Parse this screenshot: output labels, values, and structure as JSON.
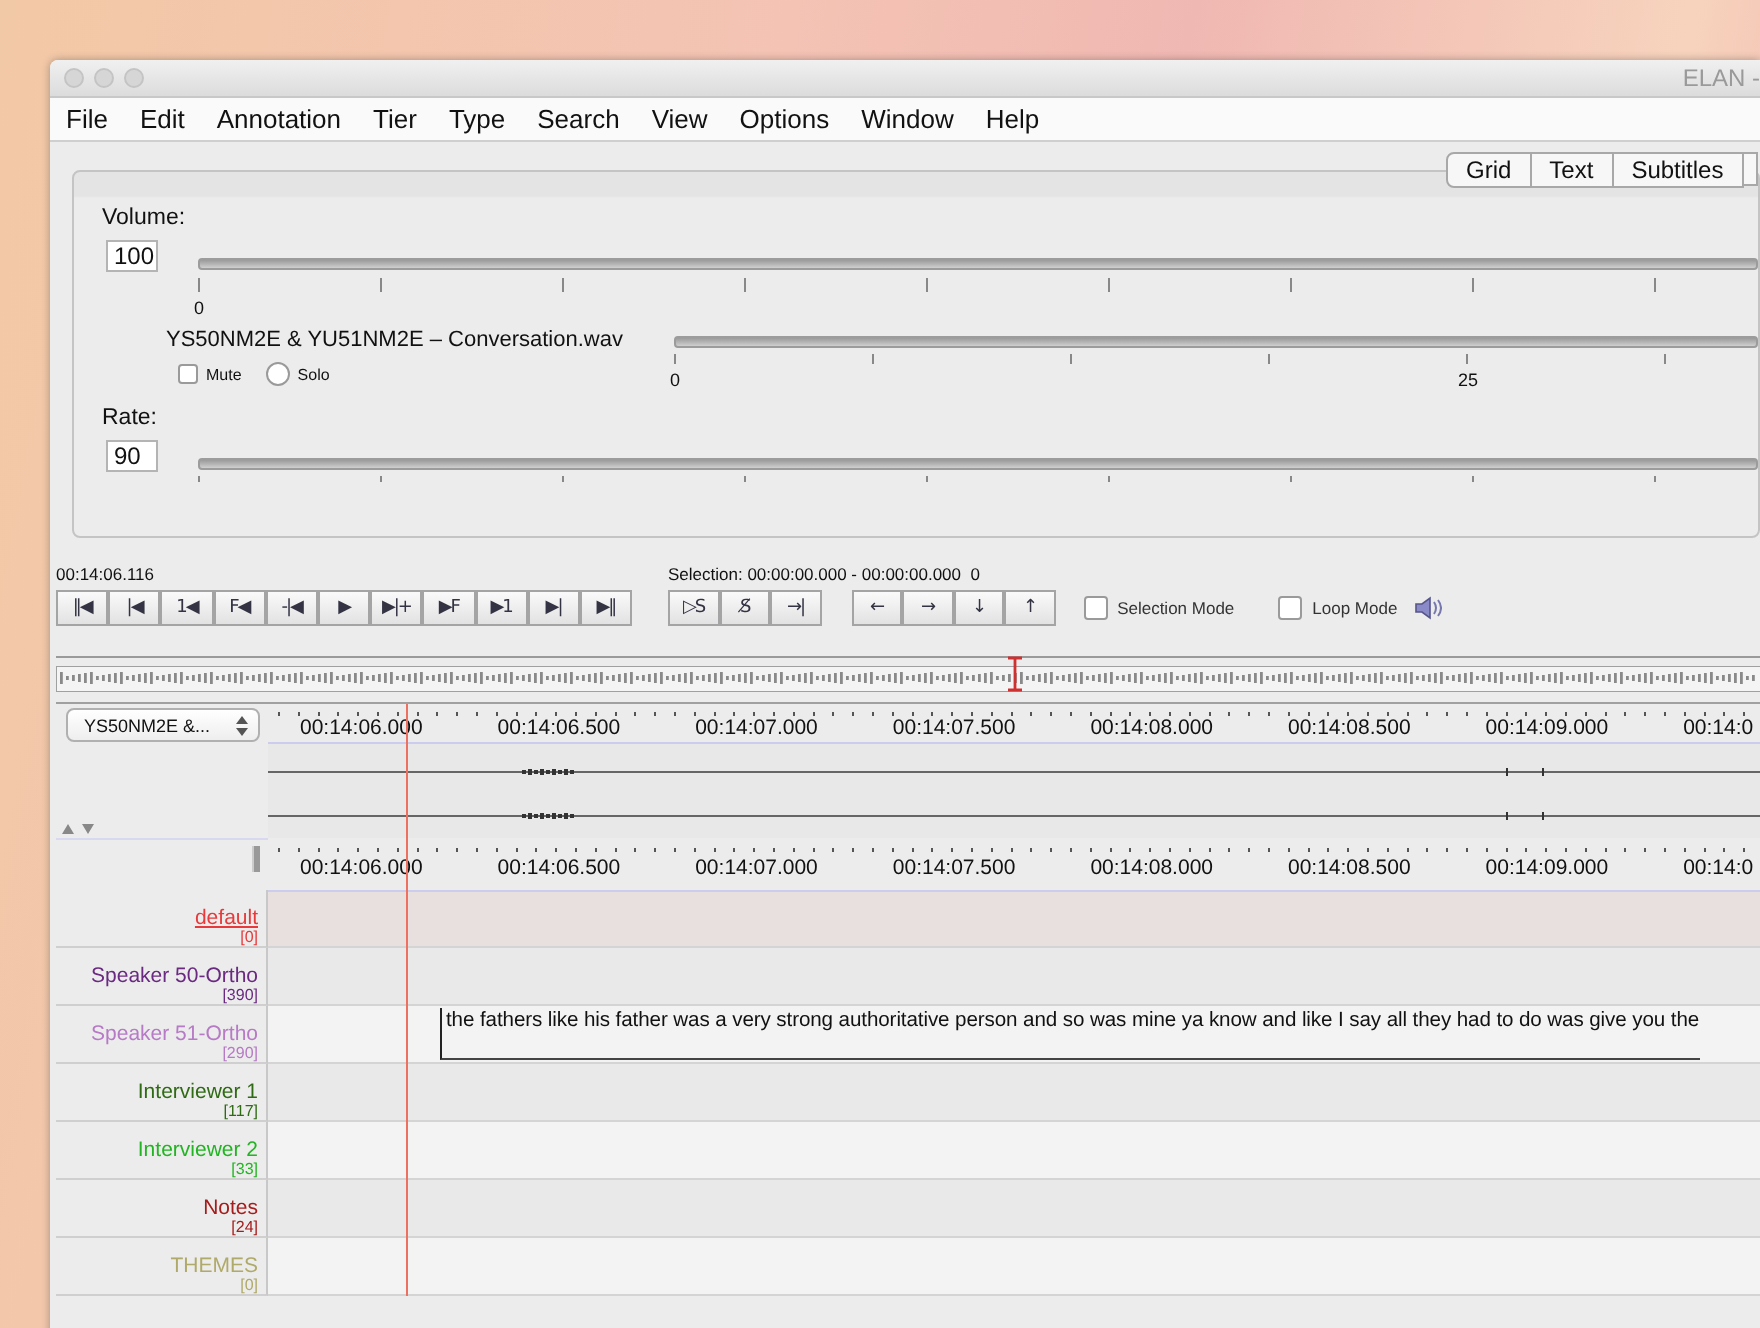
{
  "window": {
    "title": "ELAN - "
  },
  "menu": [
    "File",
    "Edit",
    "Annotation",
    "Tier",
    "Type",
    "Search",
    "View",
    "Options",
    "Window",
    "Help"
  ],
  "view_tabs": [
    {
      "label": "Grid",
      "selected": false
    },
    {
      "label": "Text",
      "selected": false
    },
    {
      "label": "Subtitles",
      "selected": false
    }
  ],
  "volume": {
    "label": "Volume:",
    "value": "100",
    "ticks": [
      "0"
    ]
  },
  "media_track": {
    "file": "YS50NM2E & YU51NM2E – Conversation.wav",
    "mute": {
      "label": "Mute",
      "checked": false
    },
    "solo": {
      "label": "Solo",
      "selected": false
    },
    "ticks": [
      "0",
      "25"
    ]
  },
  "rate": {
    "label": "Rate:",
    "value": "90"
  },
  "player": {
    "time": "00:14:06.116",
    "selection": "Selection: 00:00:00.000 - 00:00:00.000  0",
    "buttons": [
      "‖◀",
      "|◀",
      "1◀",
      "F◀",
      "-|◀",
      "▶",
      "▶|+",
      "▶F",
      "▶1",
      "▶|",
      "▶‖"
    ],
    "selection_buttons": [
      "▷S",
      "S̸",
      "→|"
    ],
    "nav_buttons": [
      "←",
      "→",
      "↓",
      "↑"
    ],
    "options": [
      {
        "label": "Selection Mode",
        "checked": false
      },
      {
        "label": "Loop Mode",
        "checked": false
      }
    ]
  },
  "timeline": {
    "tier_selector": "YS50NM2E &...",
    "ruler": [
      "00:14:06.000",
      "00:14:06.500",
      "00:14:07.000",
      "00:14:07.500",
      "00:14:08.000",
      "00:14:08.500",
      "00:14:09.000",
      "00:14:0"
    ],
    "tier_ruler": [
      "00:14:06.000",
      "00:14:06.500",
      "00:14:07.000",
      "00:14:07.500",
      "00:14:08.000",
      "00:14:08.500",
      "00:14:09.000",
      "00:14:0"
    ]
  },
  "tiers": [
    {
      "name": "default",
      "count": "[0]",
      "color": "#e83a3a",
      "selected": true
    },
    {
      "name": "Speaker 50-Ortho",
      "count": "[390]",
      "color": "#6a2a82",
      "selected": false
    },
    {
      "name": "Speaker 51-Ortho",
      "count": "[290]",
      "color": "#b67ac6",
      "selected": false,
      "annotations": [
        "the fathers like his father was a very strong authoritative person and so was mine ya know and like I say all they had to do was give you the"
      ]
    },
    {
      "name": "Interviewer 1",
      "count": "[117]",
      "color": "#2f6a14",
      "selected": false
    },
    {
      "name": "Interviewer 2",
      "count": "[33]",
      "color": "#22b422",
      "selected": false
    },
    {
      "name": "Notes",
      "count": "[24]",
      "color": "#a51c1c",
      "selected": false
    },
    {
      "name": "THEMES",
      "count": "[0]",
      "color": "#b0aa6a",
      "selected": false
    }
  ]
}
